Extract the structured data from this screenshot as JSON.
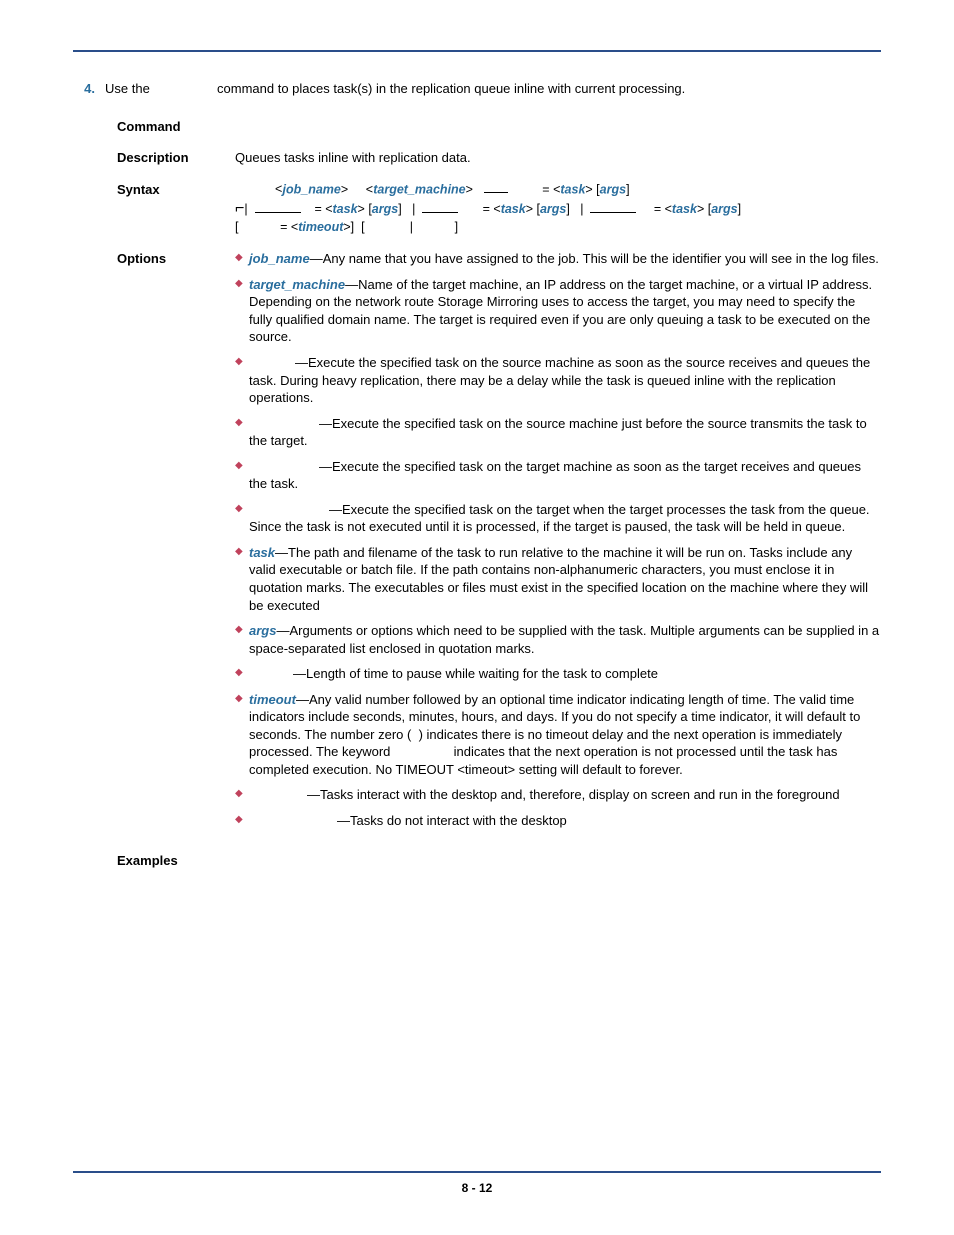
{
  "step": {
    "number": "4.",
    "text_a": "Use the ",
    "text_b": " command to places task(s) in the replication queue inline with current processing."
  },
  "labels": {
    "command": "Command",
    "description": "Description",
    "syntax": "Syntax",
    "options": "Options",
    "examples": "Examples"
  },
  "description": "Queues tasks inline with replication data.",
  "syntax": {
    "job_name": "job_name",
    "target_machine": "target_machine",
    "task": "task",
    "args": "args",
    "timeout": "timeout"
  },
  "options": {
    "job_name": {
      "key": "job_name",
      "text": "—Any name that you have assigned to the job. This will be the identifier you will see in the log files."
    },
    "target_machine": {
      "key": "target_machine",
      "text": "—Name of the target machine, an IP address on the target machine, or a virtual IP address. Depending on the network route Storage Mirroring uses to access the target, you may need to specify the fully qualified domain name. The target is required even if you are only queuing a task to be executed on the source."
    },
    "onqueue": "—Execute the specified task on the source machine as soon as the source receives and queues the task. During heavy replication, there may be a delay while the task is queued inline with the replication operations.",
    "pretransmit": "—Execute the specified task on the source machine just before the source transmits the task to the target.",
    "onreceipt": "—Execute the specified task on the target machine as soon as the target receives and queues the task.",
    "onexecute": "—Execute the specified task on the target when the target processes the task from the queue. Since the task is not executed until it is processed, if the target is paused, the task will be held in queue.",
    "task": {
      "key": "task",
      "text": "—The path and filename of the task to run relative to the machine it will be run on. Tasks include any valid executable or batch file. If the path contains non-alphanumeric characters, you must enclose it in quotation marks. The executables or files must exist in the specified location on the machine where they will be executed"
    },
    "args": {
      "key": "args",
      "text": "—Arguments or options which need to be supplied with the task. Multiple arguments can be supplied in a space-separated list enclosed in quotation marks."
    },
    "pause": "—Length of time to pause while waiting for the task to complete",
    "timeout": {
      "key": "timeout",
      "text_a": "—Any valid number followed by an optional time indicator indicating length of time. The valid time indicators include seconds, minutes, hours, and days. If you do not specify a time indicator, it will default to seconds. The number zero (",
      "text_b": ") indicates there is no timeout delay and the next operation is immediately processed. The keyword ",
      "text_c": " indicates that the next operation is not processed until the task has completed execution. No TIMEOUT <timeout> setting will default to forever."
    },
    "interact_a": "—Tasks interact with the desktop and, therefore, display on screen and run in the foreground",
    "interact_b": "—Tasks do not interact with the desktop"
  },
  "footer": "8 - 12"
}
